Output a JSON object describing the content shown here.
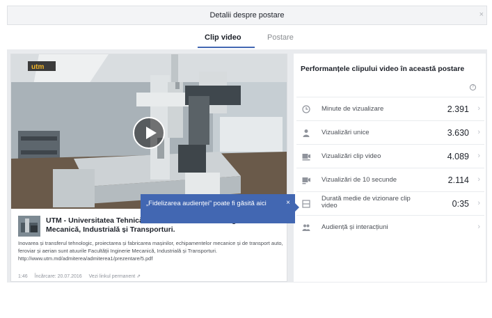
{
  "dialog": {
    "title": "Detalii despre postare",
    "close": "×"
  },
  "tabs": [
    {
      "label": "Clip video",
      "active": true
    },
    {
      "label": "Postare",
      "active": false
    }
  ],
  "tooltip": {
    "text": "„Fidelizarea audienței” poate fi găsită aici",
    "close": "×"
  },
  "post": {
    "page_name": "UTM - Universitatea Tehnică a Moldovei. Facultatea Inginerie Mecanică, Industrială și Transporturi.",
    "description": "Inovarea și transferul tehnologic, proiectarea și fabricarea mașinilor, echipamentelor mecanice și de transport auto, feroviar și aerian sunt atuurile Facultății Inginerie Mecanică, Industrială și Transporturi. http://www.utm.md/admiterea/admiterea1/prezentare/5.pdf",
    "duration": "1:46",
    "uploaded": "Încărcare: 20.07.2016",
    "permalink": "Vezi linkul permanent"
  },
  "performance": {
    "title": "Performanțele clipului video în această postare",
    "info_icon": "?",
    "metrics": [
      {
        "icon": "clock-icon",
        "label": "Minute de vizualizare",
        "value": "2.391"
      },
      {
        "icon": "person-icon",
        "label": "Vizualizări unice",
        "value": "3.630"
      },
      {
        "icon": "video-views-icon",
        "label": "Vizualizări clip video",
        "value": "4.089"
      },
      {
        "icon": "ten-second-views-icon",
        "label": "Vizualizări de 10 secunde",
        "value": "2.114"
      },
      {
        "icon": "duration-icon",
        "label": "Durată medie de vizionare clip video",
        "value": "0:35"
      },
      {
        "icon": "audience-icon",
        "label": "Audiență și interacțiuni",
        "value": ""
      }
    ],
    "chevron": "›"
  },
  "colors": {
    "accent": "#4267b2",
    "background": "#e9ebee"
  }
}
